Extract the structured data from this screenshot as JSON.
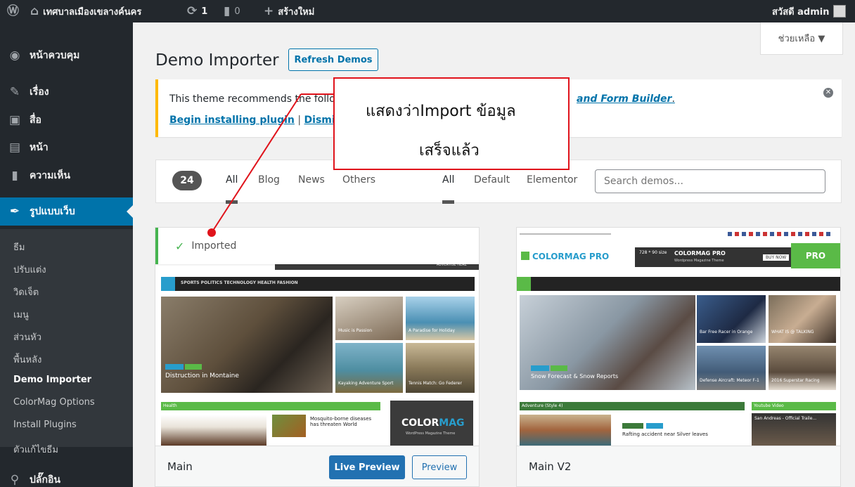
{
  "admin_bar": {
    "wp_logo": "wordpress-icon",
    "site_name": "เทศบาลเมืองเขลางค์นคร",
    "updates_count": "1",
    "comments_count": "0",
    "new_label": "สร้างใหม่",
    "greeting": "สวัสดี admin"
  },
  "sidebar": {
    "dashboard": "หน้าควบคุม",
    "posts": "เรื่อง",
    "media": "สื่อ",
    "pages": "หน้า",
    "comments": "ความเห็น",
    "appearance": "รูปแบบเว็บ",
    "plugins": "ปลั๊กอิน",
    "submenu": [
      "ธีม",
      "ปรับแต่ง",
      "วิดเจ็ต",
      "เมนู",
      "ส่วนหัว",
      "พื้นหลัง",
      "Demo Importer",
      "ColorMag Options",
      "Install Plugins",
      "ตัวแก้ไขธีม"
    ]
  },
  "header": {
    "title": "Demo Importer",
    "refresh_label": "Refresh Demos",
    "help_label": "ช่วยเหลือ ▼"
  },
  "notice": {
    "line1_start": "This theme recommends the follo",
    "line1_end": "and Form Builder",
    "line1_tail": ".",
    "install_link": "Begin installing plugin",
    "separator": " | ",
    "dismiss_link": "Dismiss th"
  },
  "filters": {
    "count": "24",
    "category_tabs": [
      "All",
      "Blog",
      "News",
      "Others"
    ],
    "builder_tabs": [
      "All",
      "Default",
      "Elementor"
    ],
    "search_placeholder": "Search demos..."
  },
  "demos": [
    {
      "name": "Main",
      "status": "Imported",
      "live_preview_label": "Live Preview",
      "preview_label": "Preview",
      "thumb": {
        "nav": "SPORTS   POLITICS   TECHNOLOGY   HEALTH   FASHION",
        "top_text": "ADVERTISE HERE",
        "main_caption": "Distruction in Montaine",
        "small_captions": [
          "Music is Passion",
          "A Paradise for Holiday",
          "Kayaking Adventure Sport",
          "Tennis Match: Go Federer"
        ],
        "section": "Health",
        "article": "Mosquito-borne diseases has threaten World",
        "brand_left": "COLOR",
        "brand_right": "MAG",
        "brand_sub": "WordPress Magazine Theme"
      }
    },
    {
      "name": "Main V2",
      "badge": "PRO",
      "thumb": {
        "logo": "COLORMAG PRO",
        "ad": "728 * 90 size",
        "ad_title": "COLORMAG PRO",
        "ad_sub": "Wordpress Magazine Theme",
        "buy": "BUY NOW",
        "main_caption": "Snow Forecast & Snow Reports",
        "small_captions": [
          "Bar Free Racer in Orange",
          "WHAT IS @ TALKING",
          "Defense Aircraft: Meteor F-1",
          "2016 Superstar Racing"
        ],
        "section_left": "Adventure (Style 4)",
        "section_right": "Youtube Video",
        "article": "Rafting accident near Silver leaves",
        "video": "San Andreas - Official Traile..."
      }
    }
  ],
  "annotation": {
    "line1": "แสดงว่าImport ข้อมูล",
    "line2": "เสร็จแล้ว"
  }
}
